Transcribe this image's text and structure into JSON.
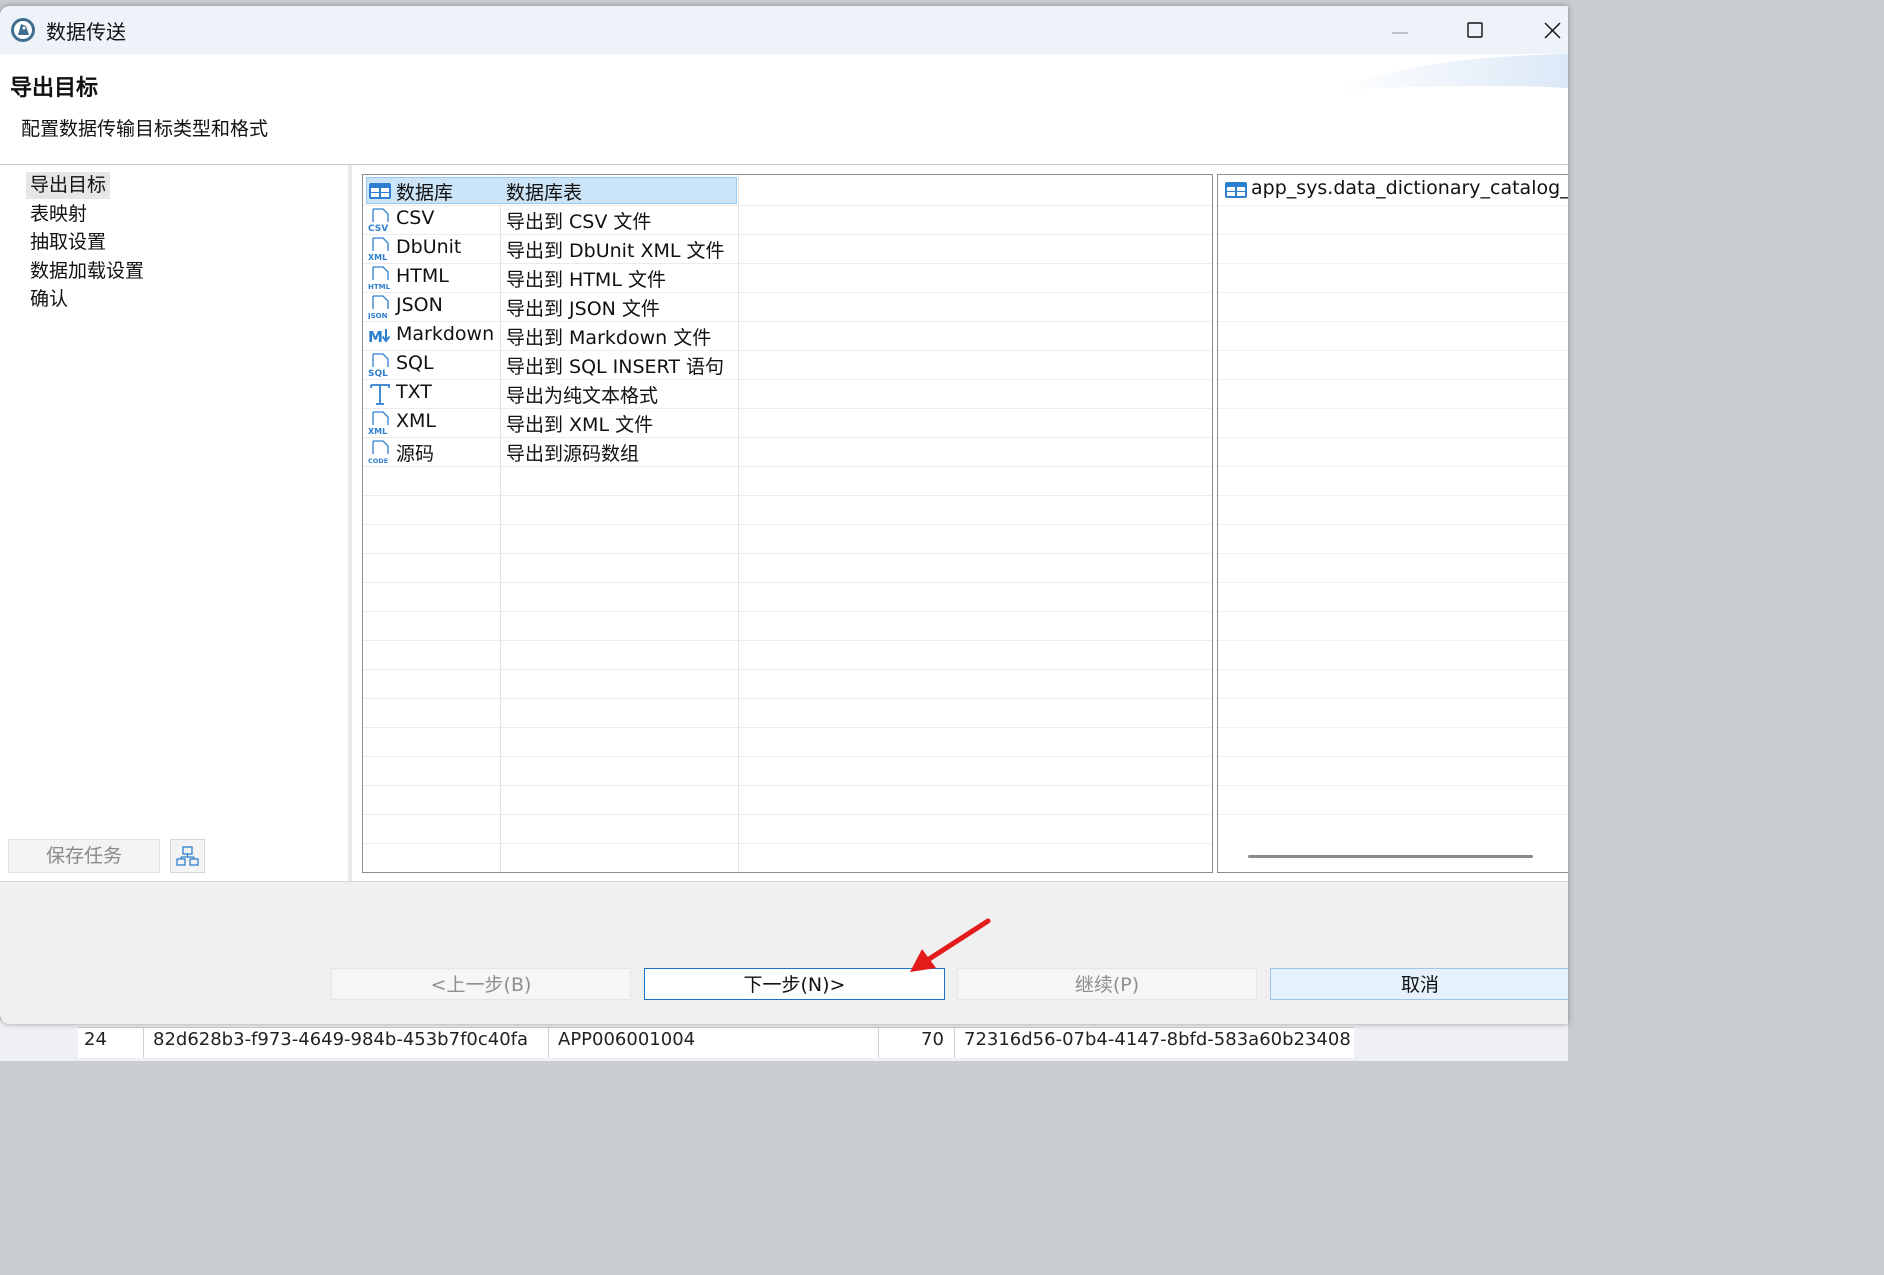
{
  "window": {
    "title": "数据传送"
  },
  "header": {
    "title": "导出目标",
    "subtitle": "配置数据传输目标类型和格式"
  },
  "nav": {
    "items": [
      "导出目标",
      "表映射",
      "抽取设置",
      "数据加载设置",
      "确认"
    ],
    "selected_index": 0
  },
  "left_panel": {
    "save_task_label": "保存任务"
  },
  "targets": [
    {
      "icon": "database-table-icon",
      "name": "数据库",
      "description": "数据库表",
      "selected": true
    },
    {
      "icon": "csv-file-icon",
      "name": "CSV",
      "description": "导出到 CSV 文件"
    },
    {
      "icon": "xml-file-icon",
      "name": "DbUnit",
      "description": "导出到 DbUnit XML 文件"
    },
    {
      "icon": "html-file-icon",
      "name": "HTML",
      "description": "导出到 HTML 文件"
    },
    {
      "icon": "json-file-icon",
      "name": "JSON",
      "description": "导出到 JSON 文件"
    },
    {
      "icon": "markdown-icon",
      "name": "Markdown",
      "description": "导出到 Markdown 文件"
    },
    {
      "icon": "sql-file-icon",
      "name": "SQL",
      "description": "导出到 SQL INSERT 语句"
    },
    {
      "icon": "text-icon",
      "name": "TXT",
      "description": "导出为纯文本格式"
    },
    {
      "icon": "xml-file-icon",
      "name": "XML",
      "description": "导出到 XML 文件"
    },
    {
      "icon": "code-file-icon",
      "name": "源码",
      "description": "导出到源码数组"
    }
  ],
  "source": {
    "table": "app_sys.data_dictionary_catalog_s"
  },
  "footer": {
    "back_label": "<上一步(B)",
    "next_label": "下一步(N)>",
    "continue_label": "继续(P)",
    "cancel_label": "取消"
  },
  "background_table": {
    "rows": [
      [
        "24",
        "82d628b3-f973-4649-984b-453b7f0c40fa",
        "APP006001004",
        "70",
        "72316d56-07b4-4147-8bfd-583a60b23408"
      ]
    ]
  },
  "colors": {
    "accent": "#1a73c6",
    "selection": "#cce4f7",
    "icon_blue": "#2f7fd0"
  }
}
